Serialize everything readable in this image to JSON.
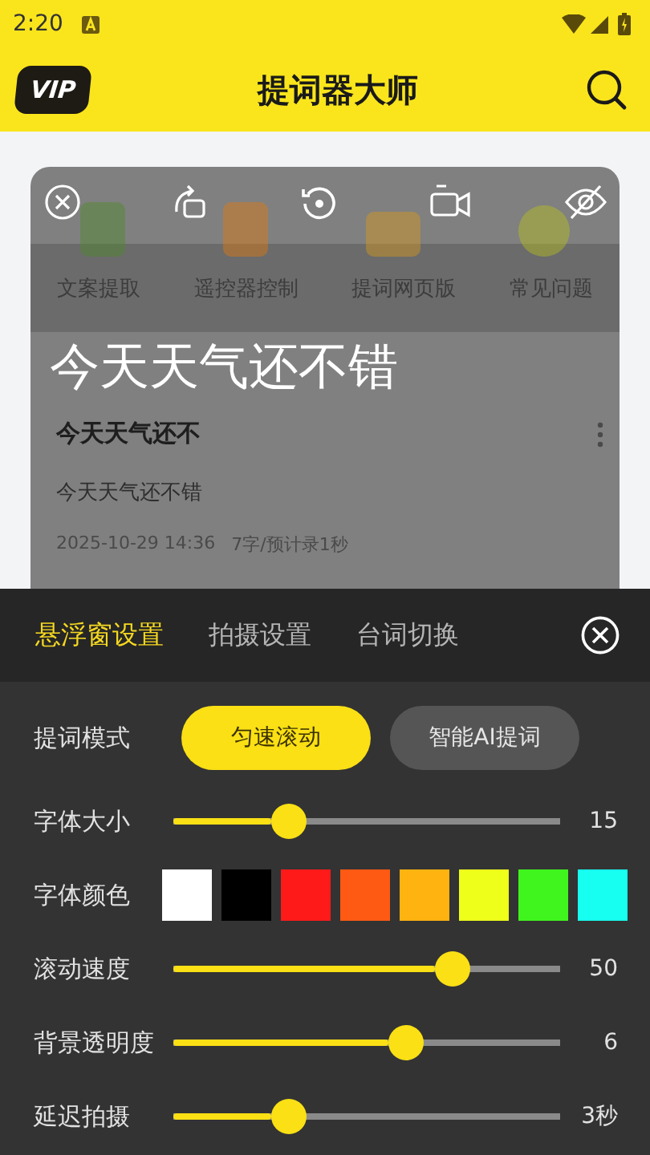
{
  "status_bar": {
    "time": "2:20"
  },
  "header": {
    "badge": "VIP",
    "title": "提词器大师"
  },
  "features": [
    {
      "label": "文案提取"
    },
    {
      "label": "遥控器控制"
    },
    {
      "label": "提词网页版"
    },
    {
      "label": "常见问题"
    }
  ],
  "prompter_text": "今天天气还不错",
  "script": {
    "title": "今天天气还不",
    "body": "今天天气还不错",
    "date": "2025-10-29 14:36",
    "stats": "7字/预计录1秒"
  },
  "panel": {
    "tabs": [
      {
        "label": "悬浮窗设置",
        "selected": true
      },
      {
        "label": "拍摄设置",
        "selected": false
      },
      {
        "label": "台词切换",
        "selected": false
      }
    ],
    "rows": [
      {
        "kind": "mode",
        "label": "提词模式",
        "options": [
          {
            "label": "匀速滚动",
            "selected": true
          },
          {
            "label": "智能AI提词",
            "selected": false
          }
        ]
      },
      {
        "kind": "slider",
        "label": "字体大小",
        "level": 0.3,
        "value": "15"
      },
      {
        "kind": "colors",
        "label": "字体颜色",
        "swatches": [
          {
            "color": "#ffffff"
          },
          {
            "color": "#000000"
          },
          {
            "color": "#ff1a1a"
          },
          {
            "color": "#ff5a14"
          },
          {
            "color": "#ffb310"
          },
          {
            "color": "#eeff1a"
          },
          {
            "color": "#40f41e"
          },
          {
            "color": "#16fff0"
          }
        ]
      },
      {
        "kind": "slider",
        "label": "滚动速度",
        "level": 0.72,
        "value": "50"
      },
      {
        "kind": "slider",
        "label": "背景透明度",
        "level": 0.6,
        "value": "6"
      },
      {
        "kind": "slider",
        "label": "延迟拍摄",
        "level": 0.3,
        "value": "3秒"
      }
    ]
  }
}
